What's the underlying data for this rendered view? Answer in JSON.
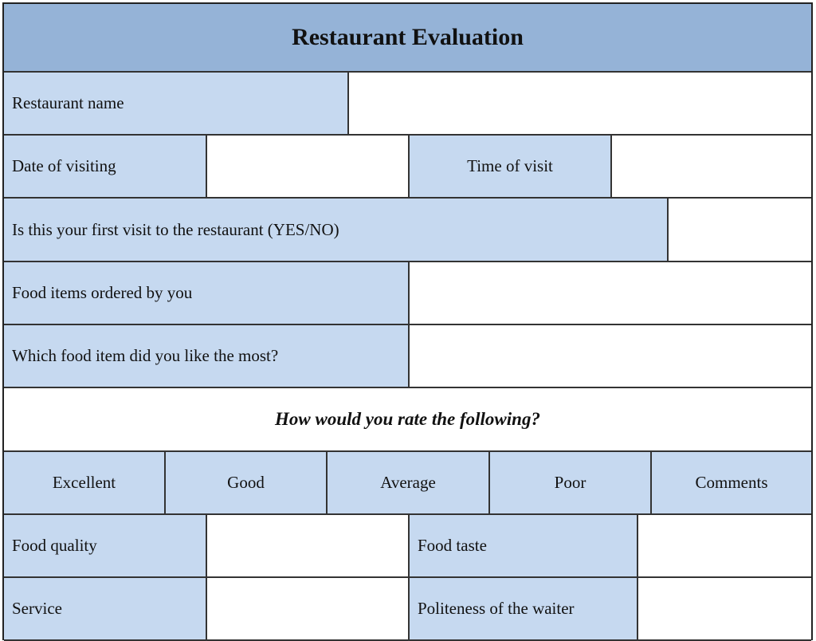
{
  "form": {
    "title": "Restaurant Evaluation",
    "fields": {
      "restaurant_name": "Restaurant name",
      "date_of_visiting": "Date of visiting",
      "time_of_visit": "Time of visit",
      "first_visit": "Is this your first visit to the restaurant (YES/NO)",
      "food_items_ordered": "Food items ordered by you",
      "liked_most": "Which food item did you like the most?"
    },
    "rating_section": {
      "heading": "How would you rate the following?",
      "scale": [
        "Excellent",
        "Good",
        "Average",
        "Poor",
        "Comments"
      ],
      "items": [
        "Food quality",
        "Food taste",
        "Service",
        "Politeness of the waiter"
      ]
    }
  }
}
